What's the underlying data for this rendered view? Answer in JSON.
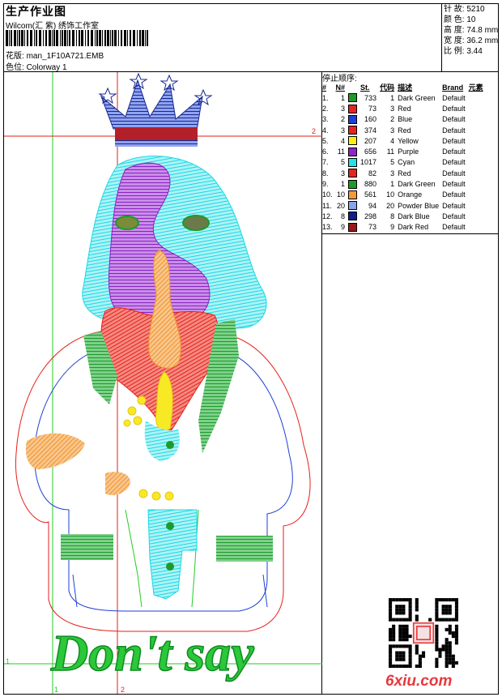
{
  "header": {
    "title": "生产作业图",
    "company": "Wilcom(汇 紫) 绣饰工作室",
    "pattern_label": "花版:",
    "pattern_value": "man_1F10A721.EMB",
    "colorway_label": "色位:",
    "colorway_value": "Colorway 1"
  },
  "stats": {
    "stitches": "针 故: 5210",
    "colors": "颜 色: 10",
    "height": "高 度: 74.8 mm",
    "width": "宽 度: 36.2 mm",
    "ratio": "比 例: 3.44"
  },
  "stop_sequence": {
    "title": "停止顺序:",
    "headers": [
      "#",
      "N#",
      "St.",
      "代码",
      "描述",
      "Brand",
      "元素"
    ],
    "rows": [
      {
        "idx": "1.",
        "n": "1",
        "color": "#1f9a2a",
        "st": "733",
        "code": "1",
        "desc": "Dark Green",
        "brand": "Default"
      },
      {
        "idx": "2.",
        "n": "3",
        "color": "#e8231f",
        "st": "73",
        "code": "3",
        "desc": "Red",
        "brand": "Default"
      },
      {
        "idx": "3.",
        "n": "2",
        "color": "#1d3fd6",
        "st": "160",
        "code": "2",
        "desc": "Blue",
        "brand": "Default"
      },
      {
        "idx": "4.",
        "n": "3",
        "color": "#e8231f",
        "st": "374",
        "code": "3",
        "desc": "Red",
        "brand": "Default"
      },
      {
        "idx": "5.",
        "n": "4",
        "color": "#ffef12",
        "st": "207",
        "code": "4",
        "desc": "Yellow",
        "brand": "Default"
      },
      {
        "idx": "6.",
        "n": "11",
        "color": "#8e25c8",
        "st": "656",
        "code": "11",
        "desc": "Purple",
        "brand": "Default"
      },
      {
        "idx": "7.",
        "n": "5",
        "color": "#22e2ea",
        "st": "1017",
        "code": "5",
        "desc": "Cyan",
        "brand": "Default"
      },
      {
        "idx": "8.",
        "n": "3",
        "color": "#e8231f",
        "st": "82",
        "code": "3",
        "desc": "Red",
        "brand": "Default"
      },
      {
        "idx": "9.",
        "n": "1",
        "color": "#1f9a2a",
        "st": "880",
        "code": "1",
        "desc": "Dark Green",
        "brand": "Default"
      },
      {
        "idx": "10.",
        "n": "10",
        "color": "#f29a3a",
        "st": "561",
        "code": "10",
        "desc": "Orange",
        "brand": "Default"
      },
      {
        "idx": "11.",
        "n": "20",
        "color": "#8aa2e8",
        "st": "94",
        "code": "20",
        "desc": "Powder Blue",
        "brand": "Default"
      },
      {
        "idx": "12.",
        "n": "8",
        "color": "#101f8a",
        "st": "298",
        "code": "8",
        "desc": "Dark Blue",
        "brand": "Default"
      },
      {
        "idx": "13.",
        "n": "9",
        "color": "#9a1818",
        "st": "73",
        "code": "9",
        "desc": "Dark Red",
        "brand": "Default"
      }
    ]
  },
  "design": {
    "text": "Don't say",
    "guide_labels": [
      "2",
      "2",
      "1",
      "1",
      "2"
    ]
  },
  "watermark": "6xiu.com"
}
